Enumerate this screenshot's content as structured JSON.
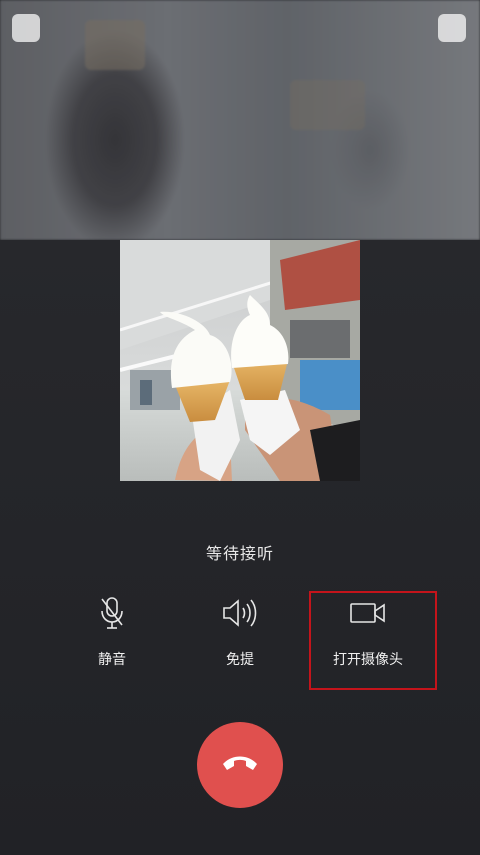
{
  "call": {
    "status_text": "等待接听"
  },
  "controls": {
    "mute_label": "静音",
    "speaker_label": "免提",
    "camera_label": "打开摄像头"
  },
  "icons": {
    "mute": "microphone-icon",
    "speaker": "speaker-icon",
    "camera": "video-camera-icon",
    "hangup": "phone-hangup-icon"
  },
  "colors": {
    "hangup": "#e0504e",
    "highlight": "#c4141b",
    "background": "#232428"
  }
}
